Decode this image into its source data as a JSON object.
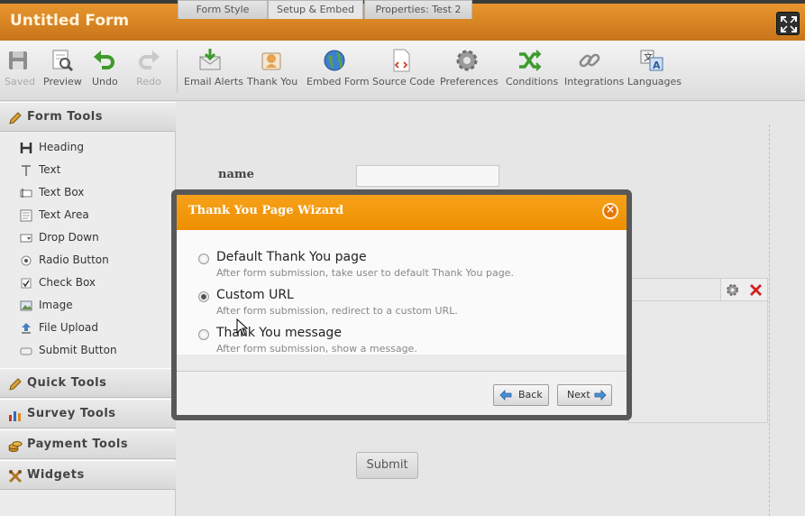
{
  "app": {
    "title": "Untitled Form"
  },
  "toolbar": {
    "items": [
      {
        "label": "Saved",
        "icon": "save-icon",
        "enabled": false
      },
      {
        "label": "Preview",
        "icon": "preview-icon",
        "enabled": true
      },
      {
        "label": "Undo",
        "icon": "undo-icon",
        "enabled": true
      },
      {
        "label": "Redo",
        "icon": "redo-icon",
        "enabled": false
      },
      {
        "label": "Email Alerts",
        "icon": "email-alerts-icon",
        "enabled": true
      },
      {
        "label": "Thank You",
        "icon": "thank-you-icon",
        "enabled": true
      },
      {
        "label": "Embed Form",
        "icon": "globe-icon",
        "enabled": true
      },
      {
        "label": "Source Code",
        "icon": "source-code-icon",
        "enabled": true
      },
      {
        "label": "Preferences",
        "icon": "gear-icon",
        "enabled": true
      },
      {
        "label": "Conditions",
        "icon": "conditions-icon",
        "enabled": true
      },
      {
        "label": "Integrations",
        "icon": "link-icon",
        "enabled": true
      },
      {
        "label": "Languages",
        "icon": "languages-icon",
        "enabled": true
      }
    ]
  },
  "sidebar": {
    "form_tools": {
      "label": "Form Tools",
      "items": [
        {
          "label": "Heading",
          "icon": "heading-icon"
        },
        {
          "label": "Text",
          "icon": "text-icon"
        },
        {
          "label": "Text Box",
          "icon": "textbox-icon"
        },
        {
          "label": "Text Area",
          "icon": "textarea-icon"
        },
        {
          "label": "Drop Down",
          "icon": "dropdown-icon"
        },
        {
          "label": "Radio Button",
          "icon": "radio-icon"
        },
        {
          "label": "Check Box",
          "icon": "checkbox-icon"
        },
        {
          "label": "Image",
          "icon": "image-icon"
        },
        {
          "label": "File Upload",
          "icon": "upload-icon"
        },
        {
          "label": "Submit Button",
          "icon": "submit-icon"
        }
      ]
    },
    "sections": [
      {
        "label": "Quick Tools",
        "icon": "pencil-icon"
      },
      {
        "label": "Survey Tools",
        "icon": "bar-chart-icon"
      },
      {
        "label": "Payment Tools",
        "icon": "coins-icon"
      },
      {
        "label": "Widgets",
        "icon": "wrench-icon"
      }
    ]
  },
  "tabs": [
    {
      "label": "Form Style"
    },
    {
      "label": "Setup & Embed"
    },
    {
      "label": "Properties: Test 2"
    }
  ],
  "form": {
    "field_label": "name",
    "submit_label": "Submit"
  },
  "modal": {
    "title": "Thank You Page Wizard",
    "options": [
      {
        "title": "Default Thank You page",
        "description": "After form submission, take user to default Thank You page.",
        "selected": false
      },
      {
        "title": "Custom URL",
        "description": "After form submission, redirect to a custom URL.",
        "selected": true
      },
      {
        "title": "Thank You message",
        "description": "After form submission, show a message.",
        "selected": false
      }
    ],
    "back_label": "Back",
    "next_label": "Next"
  },
  "colors": {
    "accent": "#f39a14",
    "titlebar": "#d88423",
    "danger": "#d42020"
  }
}
